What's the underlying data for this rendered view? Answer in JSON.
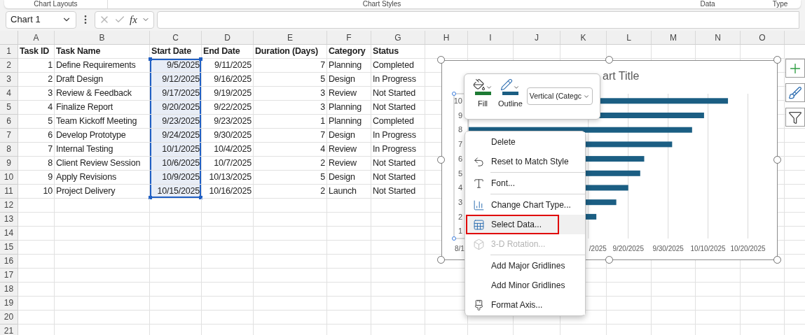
{
  "ribbon_groups": [
    "Chart Layouts",
    "Chart Styles",
    "Data",
    "Type"
  ],
  "name_box": {
    "value": "Chart 1"
  },
  "formula_bar": {
    "function_label": "fx"
  },
  "sheet": {
    "columns": [
      "A",
      "B",
      "C",
      "D",
      "E",
      "F",
      "G",
      "H",
      "I",
      "J",
      "K",
      "L",
      "M",
      "N",
      "O"
    ],
    "header_row": {
      "number": "1",
      "cells": [
        "Task ID",
        "Task Name",
        "Start Date",
        "End Date",
        "Duration (Days)",
        "Category",
        "Status"
      ]
    },
    "rows": [
      {
        "number": "2",
        "cells": [
          {
            "text": "1",
            "selected": false
          },
          {
            "text": "Define Requirements",
            "selected": false
          },
          {
            "text": "9/5/2025",
            "selected": true
          },
          {
            "text": "9/11/2025",
            "selected": false
          },
          {
            "text": "7",
            "selected": false
          },
          {
            "text": "Planning",
            "selected": false
          },
          {
            "text": "Completed",
            "selected": false
          }
        ]
      },
      {
        "number": "3",
        "cells": [
          {
            "text": "2",
            "selected": false
          },
          {
            "text": "Draft Design",
            "selected": false
          },
          {
            "text": "9/12/2025",
            "selected": true
          },
          {
            "text": "9/16/2025",
            "selected": false
          },
          {
            "text": "5",
            "selected": false
          },
          {
            "text": "Design",
            "selected": false
          },
          {
            "text": "In Progress",
            "selected": false
          }
        ]
      },
      {
        "number": "4",
        "cells": [
          {
            "text": "3",
            "selected": false
          },
          {
            "text": "Review & Feedback",
            "selected": false
          },
          {
            "text": "9/17/2025",
            "selected": true
          },
          {
            "text": "9/19/2025",
            "selected": false
          },
          {
            "text": "3",
            "selected": false
          },
          {
            "text": "Review",
            "selected": false
          },
          {
            "text": "Not Started",
            "selected": false
          }
        ]
      },
      {
        "number": "5",
        "cells": [
          {
            "text": "4",
            "selected": false
          },
          {
            "text": "Finalize Report",
            "selected": false
          },
          {
            "text": "9/20/2025",
            "selected": true
          },
          {
            "text": "9/22/2025",
            "selected": false
          },
          {
            "text": "3",
            "selected": false
          },
          {
            "text": "Planning",
            "selected": false
          },
          {
            "text": "Not Started",
            "selected": false
          }
        ]
      },
      {
        "number": "6",
        "cells": [
          {
            "text": "5",
            "selected": false
          },
          {
            "text": "Team Kickoff Meeting",
            "selected": false
          },
          {
            "text": "9/23/2025",
            "selected": true
          },
          {
            "text": "9/23/2025",
            "selected": false
          },
          {
            "text": "1",
            "selected": false
          },
          {
            "text": "Planning",
            "selected": false
          },
          {
            "text": "Completed",
            "selected": false
          }
        ]
      },
      {
        "number": "7",
        "cells": [
          {
            "text": "6",
            "selected": false
          },
          {
            "text": "Develop Prototype",
            "selected": false
          },
          {
            "text": "9/24/2025",
            "selected": true
          },
          {
            "text": "9/30/2025",
            "selected": false
          },
          {
            "text": "7",
            "selected": false
          },
          {
            "text": "Design",
            "selected": false
          },
          {
            "text": "In Progress",
            "selected": false
          }
        ]
      },
      {
        "number": "8",
        "cells": [
          {
            "text": "7",
            "selected": false
          },
          {
            "text": "Internal Testing",
            "selected": false
          },
          {
            "text": "10/1/2025",
            "selected": true
          },
          {
            "text": "10/4/2025",
            "selected": false
          },
          {
            "text": "4",
            "selected": false
          },
          {
            "text": "Review",
            "selected": false
          },
          {
            "text": "In Progress",
            "selected": false
          }
        ]
      },
      {
        "number": "9",
        "cells": [
          {
            "text": "8",
            "selected": false
          },
          {
            "text": "Client Review Session",
            "selected": false
          },
          {
            "text": "10/6/2025",
            "selected": true
          },
          {
            "text": "10/7/2025",
            "selected": false
          },
          {
            "text": "2",
            "selected": false
          },
          {
            "text": "Review",
            "selected": false
          },
          {
            "text": "Not Started",
            "selected": false
          }
        ]
      },
      {
        "number": "10",
        "cells": [
          {
            "text": "9",
            "selected": false
          },
          {
            "text": "Apply Revisions",
            "selected": false
          },
          {
            "text": "10/9/2025",
            "selected": true
          },
          {
            "text": "10/13/2025",
            "selected": false
          },
          {
            "text": "5",
            "selected": false
          },
          {
            "text": "Design",
            "selected": false
          },
          {
            "text": "Not Started",
            "selected": false
          }
        ]
      },
      {
        "number": "11",
        "cells": [
          {
            "text": "10",
            "selected": false
          },
          {
            "text": "Project Delivery",
            "selected": false
          },
          {
            "text": "10/15/2025",
            "selected": true
          },
          {
            "text": "10/16/2025",
            "selected": false
          },
          {
            "text": "2",
            "selected": false
          },
          {
            "text": "Launch",
            "selected": false
          },
          {
            "text": "Not Started",
            "selected": false
          }
        ]
      },
      {
        "number": "12"
      },
      {
        "number": "13"
      },
      {
        "number": "14"
      },
      {
        "number": "15"
      },
      {
        "number": "16"
      },
      {
        "number": "17"
      },
      {
        "number": "18"
      },
      {
        "number": "19"
      },
      {
        "number": "20"
      },
      {
        "number": "21"
      }
    ]
  },
  "chart": {
    "title": "art Title",
    "x_axis_labels": [
      "8/1",
      "/2025",
      "9/20/2025",
      "9/30/2025",
      "10/10/2025",
      "10/20/2025"
    ],
    "y_axis_labels": [
      "10",
      "9",
      "8",
      "7",
      "6",
      "5",
      "4",
      "3",
      "2",
      "1"
    ]
  },
  "mini_toolbar": {
    "buttons": [
      {
        "label": "Fill",
        "color": "#1e7b34"
      },
      {
        "label": "Outline",
        "color": "#1b5e83"
      }
    ],
    "element_dropdown": {
      "value": "Vertical (Categc"
    }
  },
  "context_menu": [
    {
      "kind": "item",
      "label": "Delete",
      "selected": false,
      "disabled": false,
      "highlighted": false
    },
    {
      "kind": "item",
      "label": "Reset to Match Style",
      "selected": false,
      "disabled": false,
      "highlighted": false
    },
    {
      "kind": "separator"
    },
    {
      "kind": "item",
      "label": "Font...",
      "selected": false,
      "disabled": false,
      "highlighted": false
    },
    {
      "kind": "separator"
    },
    {
      "kind": "item",
      "label": "Change Chart Type...",
      "selected": false,
      "disabled": false,
      "highlighted": false
    },
    {
      "kind": "item",
      "label": "Select Data...",
      "selected": true,
      "disabled": false,
      "highlighted": true
    },
    {
      "kind": "item",
      "label": "3-D Rotation...",
      "selected": false,
      "disabled": true,
      "highlighted": false
    },
    {
      "kind": "separator"
    },
    {
      "kind": "item",
      "label": "Add Major Gridlines",
      "selected": false,
      "disabled": false,
      "highlighted": false
    },
    {
      "kind": "item",
      "label": "Add Minor Gridlines",
      "selected": false,
      "disabled": false,
      "highlighted": false
    },
    {
      "kind": "item",
      "label": "Format Axis...",
      "selected": false,
      "disabled": false,
      "highlighted": false
    }
  ]
}
